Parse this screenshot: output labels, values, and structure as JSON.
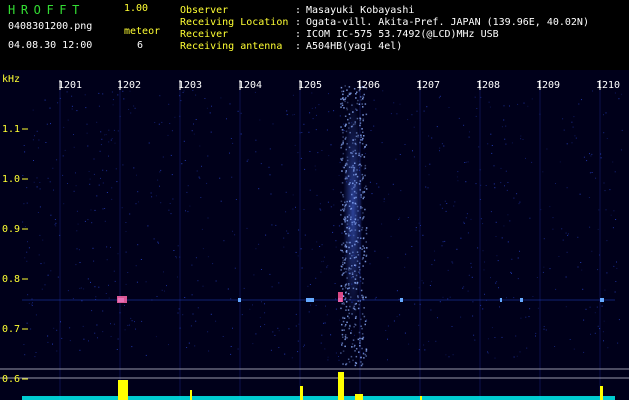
{
  "header": {
    "app_name": "HROFFT",
    "version": "1.00",
    "filename": "0408301200.png",
    "meteor_label": "meteor",
    "meteor_count": "6",
    "datetime": "04.08.30 12:00"
  },
  "metadata": [
    {
      "key": "Observer",
      "value": "Masayuki Kobayashi"
    },
    {
      "key": "Receiving Location",
      "value": "Ogata-vill. Akita-Pref. JAPAN (139.96E, 40.02N)"
    },
    {
      "key": "Receiver",
      "value": "ICOM IC-575 53.7492(@LCD)MHz USB"
    },
    {
      "key": "Receiving antenna",
      "value": "A504HB(yagi 4el)"
    }
  ],
  "axes": {
    "y_unit": "kHz",
    "y_ticks": [
      "1.1",
      "1.0",
      "0.9",
      "0.8",
      "0.7",
      "0.6"
    ],
    "x_ticks": [
      "1201",
      "1202",
      "1203",
      "1204",
      "1205",
      "1206",
      "1207",
      "1208",
      "1209",
      "1210"
    ]
  },
  "colors": {
    "background": "#00001a",
    "signal": "#3355ff",
    "meteor_echo": "#ffff00",
    "trace": "#00ffff",
    "label_yellow": "#ffff33",
    "brand_green": "#33dd33"
  }
}
